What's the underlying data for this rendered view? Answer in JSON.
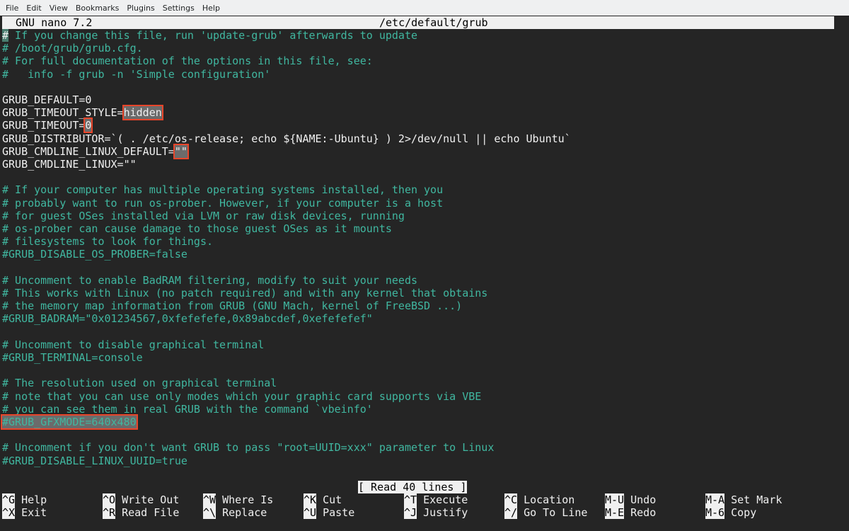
{
  "menubar": {
    "items": [
      "File",
      "Edit",
      "View",
      "Bookmarks",
      "Plugins",
      "Settings",
      "Help"
    ]
  },
  "titlebar": {
    "app": "GNU nano 7.2",
    "file": "/etc/default/grub"
  },
  "lines": {
    "l0_rest": " If you change this file, run 'update-grub' afterwards to update",
    "l0_cursor": "#",
    "l1": "# /boot/grub/grub.cfg.",
    "l2": "# For full documentation of the options in this file, see:",
    "l3": "#   info -f grub -n 'Simple configuration'",
    "l5": "GRUB_DEFAULT=0",
    "l6_a": "GRUB_TIMEOUT_STYLE=",
    "l6_b": "hidden",
    "l7_a": "GRUB_TIMEOUT=",
    "l7_b": "0",
    "l8": "GRUB_DISTRIBUTOR=`( . /etc/os-release; echo ${NAME:-Ubuntu} ) 2>/dev/null || echo Ubuntu`",
    "l9_a": "GRUB_CMDLINE_LINUX_DEFAULT=",
    "l9_b": "\"\"",
    "l10": "GRUB_CMDLINE_LINUX=\"\"",
    "l12": "# If your computer has multiple operating systems installed, then you",
    "l13": "# probably want to run os-prober. However, if your computer is a host",
    "l14": "# for guest OSes installed via LVM or raw disk devices, running",
    "l15": "# os-prober can cause damage to those guest OSes as it mounts",
    "l16": "# filesystems to look for things.",
    "l17": "#GRUB_DISABLE_OS_PROBER=false",
    "l19": "# Uncomment to enable BadRAM filtering, modify to suit your needs",
    "l20": "# This works with Linux (no patch required) and with any kernel that obtains",
    "l21": "# the memory map information from GRUB (GNU Mach, kernel of FreeBSD ...)",
    "l22": "#GRUB_BADRAM=\"0x01234567,0xfefefefe,0x89abcdef,0xefefefef\"",
    "l24": "# Uncomment to disable graphical terminal",
    "l25": "#GRUB_TERMINAL=console",
    "l27": "# The resolution used on graphical terminal",
    "l28": "# note that you can use only modes which your graphic card supports via VBE",
    "l29": "# you can see them in real GRUB with the command `vbeinfo'",
    "l30": "#GRUB_GFXMODE=640x480",
    "l32": "# Uncomment if you don't want GRUB to pass \"root=UUID=xxx\" parameter to Linux",
    "l33": "#GRUB_DISABLE_LINUX_UUID=true"
  },
  "status": "[ Read 40 lines ]",
  "shortcuts": [
    {
      "key": "^G",
      "label": "Help"
    },
    {
      "key": "^O",
      "label": "Write Out"
    },
    {
      "key": "^W",
      "label": "Where Is"
    },
    {
      "key": "^K",
      "label": "Cut"
    },
    {
      "key": "^T",
      "label": "Execute"
    },
    {
      "key": "^C",
      "label": "Location"
    },
    {
      "key": "M-U",
      "label": "Undo"
    },
    {
      "key": "M-A",
      "label": "Set Mark"
    },
    {
      "key": "^X",
      "label": "Exit"
    },
    {
      "key": "^R",
      "label": "Read File"
    },
    {
      "key": "^\\",
      "label": "Replace"
    },
    {
      "key": "^U",
      "label": "Paste"
    },
    {
      "key": "^J",
      "label": "Justify"
    },
    {
      "key": "^/",
      "label": "Go To Line"
    },
    {
      "key": "M-E",
      "label": "Redo"
    },
    {
      "key": "M-6",
      "label": "Copy"
    }
  ],
  "colors": {
    "comment": "#40b7a0",
    "code": "#f0f0f0",
    "background": "#252525",
    "highlight_border": "#e8452a"
  }
}
